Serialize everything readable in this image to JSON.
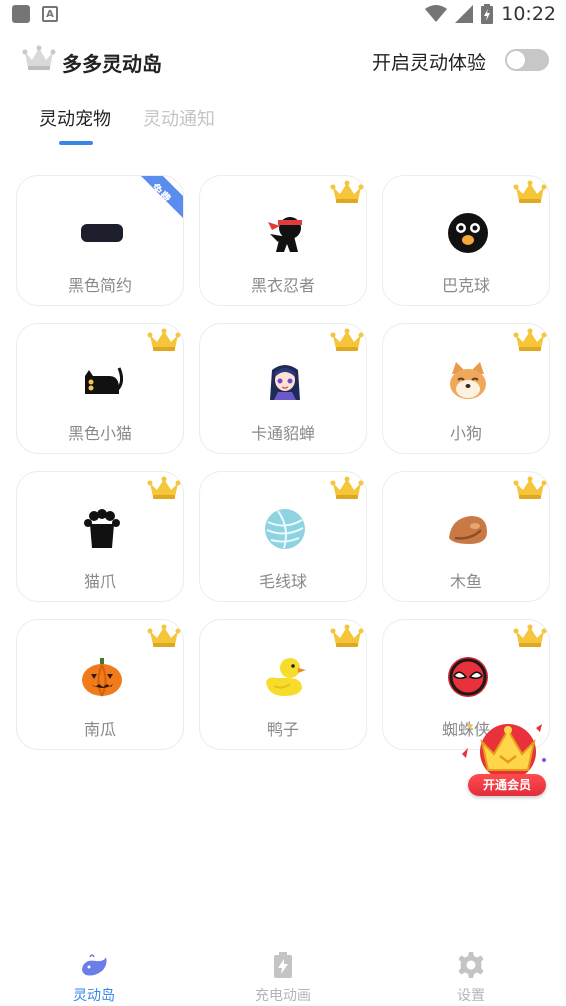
{
  "status_bar": {
    "time": "10:22"
  },
  "header": {
    "app_title": "多多灵动岛",
    "toggle_label": "开启灵动体验",
    "toggle_on": false
  },
  "tabs": [
    {
      "label": "灵动宠物",
      "active": true
    },
    {
      "label": "灵动通知",
      "active": false
    }
  ],
  "pets": [
    {
      "label": "黑色简约",
      "icon": "black-pill-icon",
      "badge": "免费"
    },
    {
      "label": "黑衣忍者",
      "icon": "ninja-icon",
      "badge": "crown"
    },
    {
      "label": "巴克球",
      "icon": "black-ball-icon",
      "badge": "crown"
    },
    {
      "label": "黑色小猫",
      "icon": "black-cat-icon",
      "badge": "crown"
    },
    {
      "label": "卡通貂蝉",
      "icon": "cartoon-girl-icon",
      "badge": "crown"
    },
    {
      "label": "小狗",
      "icon": "shiba-dog-icon",
      "badge": "crown"
    },
    {
      "label": "猫爪",
      "icon": "cat-paw-icon",
      "badge": "crown"
    },
    {
      "label": "毛线球",
      "icon": "yarn-ball-icon",
      "badge": "crown"
    },
    {
      "label": "木鱼",
      "icon": "wooden-fish-icon",
      "badge": "crown"
    },
    {
      "label": "南瓜",
      "icon": "pumpkin-icon",
      "badge": "crown"
    },
    {
      "label": "鸭子",
      "icon": "duck-icon",
      "badge": "crown"
    },
    {
      "label": "蜘蛛侠",
      "icon": "spiderman-icon",
      "badge": "crown"
    }
  ],
  "vip_button": {
    "label": "开通会员"
  },
  "bottom_nav": [
    {
      "label": "灵动岛",
      "icon": "whale-icon",
      "active": true
    },
    {
      "label": "充电动画",
      "icon": "battery-charge-icon",
      "active": false
    },
    {
      "label": "设置",
      "icon": "gear-icon",
      "active": false
    }
  ],
  "colors": {
    "accent": "#3a86e8",
    "crown": "#f5c53a",
    "vip_red": "#e22d3c"
  }
}
